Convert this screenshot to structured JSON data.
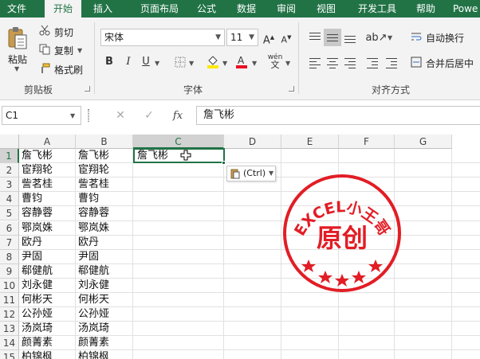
{
  "ribbon_tabs": {
    "file": "文件",
    "home": "开始",
    "insert": "插入",
    "layout": "页面布局",
    "formulas": "公式",
    "data": "数据",
    "review": "审阅",
    "view": "视图",
    "developer": "开发工具",
    "help": "帮助",
    "power": "Powe"
  },
  "clipboard": {
    "paste": "粘贴",
    "cut": "剪切",
    "copy": "复制",
    "format_painter": "格式刷",
    "group_label": "剪贴板"
  },
  "font": {
    "name": "宋体",
    "size": "11",
    "grow": "A",
    "shrink": "A",
    "bold": "B",
    "italic": "I",
    "underline": "U",
    "phonetic": "wén",
    "font_color_glyph": "A",
    "group_label": "字体"
  },
  "alignment": {
    "wrap_text": "自动换行",
    "merge_center": "合并后居中",
    "group_label": "对齐方式"
  },
  "formula_bar": {
    "name_box": "C1",
    "cancel": "✕",
    "enter": "✓",
    "fx": "fx",
    "content": "詹飞彬"
  },
  "sheet": {
    "columns": [
      "A",
      "B",
      "C",
      "D",
      "E",
      "F",
      "G"
    ],
    "rows": [
      "1",
      "2",
      "3",
      "4",
      "5",
      "6",
      "7",
      "8",
      "9",
      "10",
      "11",
      "12",
      "13",
      "14",
      "15"
    ],
    "names_a": [
      "詹飞彬",
      "宦翔轮",
      "訾茗桂",
      "曹钧",
      "容静蓉",
      "鄂岚姝",
      "欧丹",
      "尹固",
      "郗健航",
      "刘永健",
      "何彬天",
      "公孙娅",
      "汤岚琦",
      "颜菁素",
      "柏锦枫"
    ],
    "names_b": [
      "詹飞彬",
      "宦翔轮",
      "訾茗桂",
      "曹钧",
      "容静蓉",
      "鄂岚姝",
      "欧丹",
      "尹固",
      "郗健航",
      "刘永健",
      "何彬天",
      "公孙娅",
      "汤岚琦",
      "颜菁素",
      "柏锦枫"
    ],
    "c1_value": "詹飞彬",
    "paste_options_label": "(Ctrl)"
  },
  "stamp": {
    "arc_text": "EXCEL小王哥",
    "center_text": "原创"
  },
  "colors": {
    "excel_green": "#217346",
    "stamp_red": "#e21d25",
    "font_color_bar": "#e81123",
    "fill_color_bar": "#ffe900"
  }
}
